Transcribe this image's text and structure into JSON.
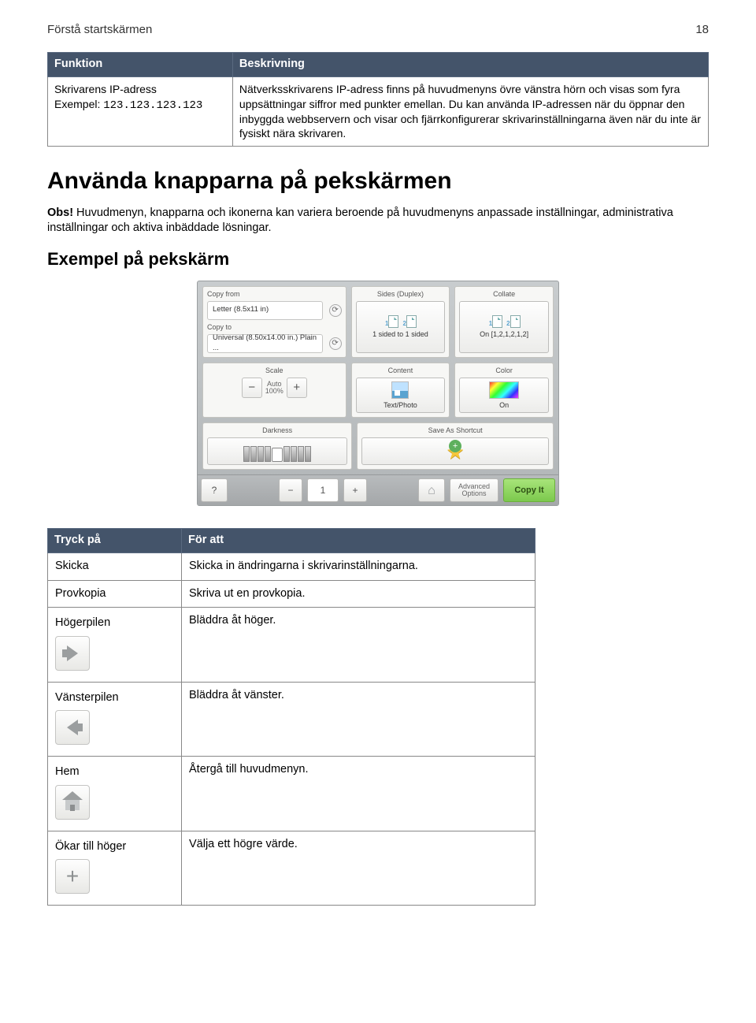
{
  "header": {
    "title": "Förstå startskärmen",
    "page": "18"
  },
  "table1": {
    "cols": [
      "Funktion",
      "Beskrivning"
    ],
    "row": {
      "c1_line1": "Skrivarens IP-adress",
      "c1_line2a": "Exempel: ",
      "c1_line2b": "123.123.123.123",
      "c2": "Nätverksskrivarens IP-adress finns på huvudmenyns övre vänstra hörn och visas som fyra uppsättningar siffror med punkter emellan. Du kan använda IP-adressen när du öppnar den inbyggda webbservern och visar och fjärrkonfigurerar skrivarinställningarna även när du inte är fysiskt nära skrivaren."
    }
  },
  "h1": "Använda knapparna på pekskärmen",
  "p1a": "Obs!",
  "p1b": " Huvudmenyn, knapparna och ikonerna kan variera beroende på huvudmenyns anpassade inställningar, administrativa inställningar och aktiva inbäddade lösningar.",
  "h2": "Exempel på pekskärm",
  "ts": {
    "copy_from_label": "Copy from",
    "copy_from_value": "Letter (8.5x11 in)",
    "copy_to_label": "Copy to",
    "copy_to_value": "Universal (8.50x14.00 in.) Plain ...",
    "sides_label": "Sides (Duplex)",
    "sides_value": "1 sided to 1 sided",
    "collate_label": "Collate",
    "collate_value": "On [1,2,1,2,1,2]",
    "scale_label": "Scale",
    "scale_auto": "Auto",
    "scale_pct": "100%",
    "darkness_label": "Darkness",
    "content_label": "Content",
    "content_value": "Text/Photo",
    "color_label": "Color",
    "color_value": "On",
    "shortcut": "Save As Shortcut",
    "copies": "1",
    "adv": "Advanced\nOptions",
    "copyit": "Copy It"
  },
  "table2": {
    "cols": [
      "Tryck på",
      "För att"
    ],
    "rows": [
      {
        "c1": "Skicka",
        "c2": "Skicka in ändringarna i skrivarinställningarna."
      },
      {
        "c1": "Provkopia",
        "c2": "Skriva ut en provkopia."
      },
      {
        "c1": "Högerpilen",
        "c2": "Bläddra åt höger.",
        "icon": "right"
      },
      {
        "c1": "Vänsterpilen",
        "c2": "Bläddra åt vänster.",
        "icon": "left"
      },
      {
        "c1": "Hem",
        "c2": "Återgå till huvudmenyn.",
        "icon": "home"
      },
      {
        "c1": "Ökar till höger",
        "c2": "Välja ett högre värde.",
        "icon": "plus"
      }
    ]
  }
}
